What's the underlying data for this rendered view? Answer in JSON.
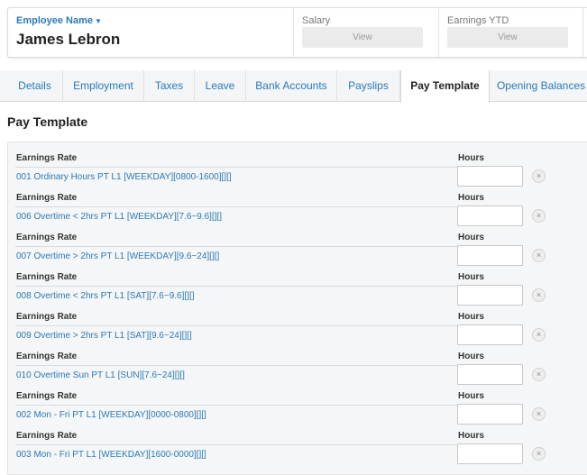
{
  "employee": {
    "label": "Employee Name",
    "name": "James Lebron"
  },
  "summary": {
    "salary_label": "Salary",
    "salary_button": "View",
    "earnings_ytd_label": "Earnings YTD",
    "earnings_ytd_button": "View"
  },
  "tabs": [
    {
      "label": "Details",
      "active": false
    },
    {
      "label": "Employment",
      "active": false
    },
    {
      "label": "Taxes",
      "active": false
    },
    {
      "label": "Leave",
      "active": false
    },
    {
      "label": "Bank Accounts",
      "active": false
    },
    {
      "label": "Payslips",
      "active": false
    },
    {
      "label": "Pay Template",
      "active": true
    },
    {
      "label": "Opening Balances",
      "active": false
    }
  ],
  "section_title": "Pay Template",
  "pay_template": {
    "rate_header": "Earnings Rate",
    "hours_header": "Hours",
    "rows": [
      {
        "rate": "001 Ordinary Hours PT L1 [WEEKDAY][0800-1600][][]",
        "hours": ""
      },
      {
        "rate": "006 Overtime < 2hrs PT L1 [WEEKDAY][7.6~9.6][][]",
        "hours": ""
      },
      {
        "rate": "007 Overtime > 2hrs PT L1 [WEEKDAY][9.6~24][][]",
        "hours": ""
      },
      {
        "rate": "008 Overtime < 2hrs PT L1 [SAT][7.6~9.6][][]",
        "hours": ""
      },
      {
        "rate": "009 Overtime > 2hrs PT L1 [SAT][9.6~24][][]",
        "hours": ""
      },
      {
        "rate": "010 Overtime Sun PT L1 [SUN][7.6~24][][]",
        "hours": ""
      },
      {
        "rate": "002 Mon - Fri PT L1 [WEEKDAY][0000-0800][][]",
        "hours": ""
      },
      {
        "rate": "003 Mon - Fri PT L1 [WEEKDAY][1600-0000][][]",
        "hours": ""
      }
    ]
  },
  "colors": {
    "link": "#2a7ab7",
    "tab_bar": "#f3f5f7",
    "panel": "#f5f6f7"
  }
}
